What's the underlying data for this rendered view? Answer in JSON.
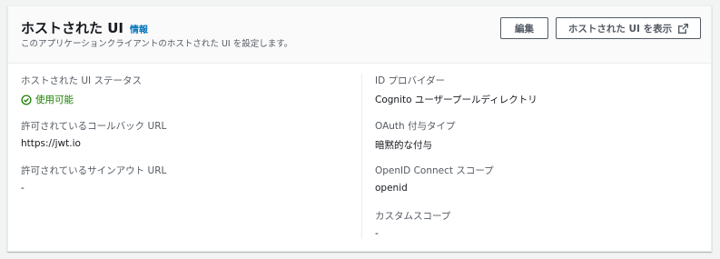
{
  "header": {
    "title": "ホストされた UI",
    "info_link": "情報",
    "description": "このアプリケーションクライアントのホストされた UI を設定します。",
    "edit_button": "編集",
    "view_button": "ホストされた UI を表示",
    "view_button_icon": "external-link-icon"
  },
  "left_column": {
    "status": {
      "label": "ホストされた UI ステータス",
      "value": "使用可能",
      "icon": "check-circle-icon",
      "color": "#1d8102"
    },
    "callback_urls": {
      "label": "許可されているコールバック URL",
      "value": "https://jwt.io"
    },
    "signout_urls": {
      "label": "許可されているサインアウト URL",
      "value": "-"
    }
  },
  "right_column": {
    "identity_provider": {
      "label": "ID プロバイダー",
      "value": "Cognito ユーザープールディレクトリ"
    },
    "oauth_grant_types": {
      "label": "OAuth 付与タイプ",
      "value": "暗黙的な付与"
    },
    "openid_scopes": {
      "label": "OpenID Connect スコープ",
      "value": "openid"
    },
    "custom_scopes": {
      "label": "カスタムスコープ",
      "value": "-"
    }
  },
  "colors": {
    "link": "#0073bb",
    "success": "#1d8102",
    "text": "#16191f",
    "secondary_text": "#545b64"
  }
}
